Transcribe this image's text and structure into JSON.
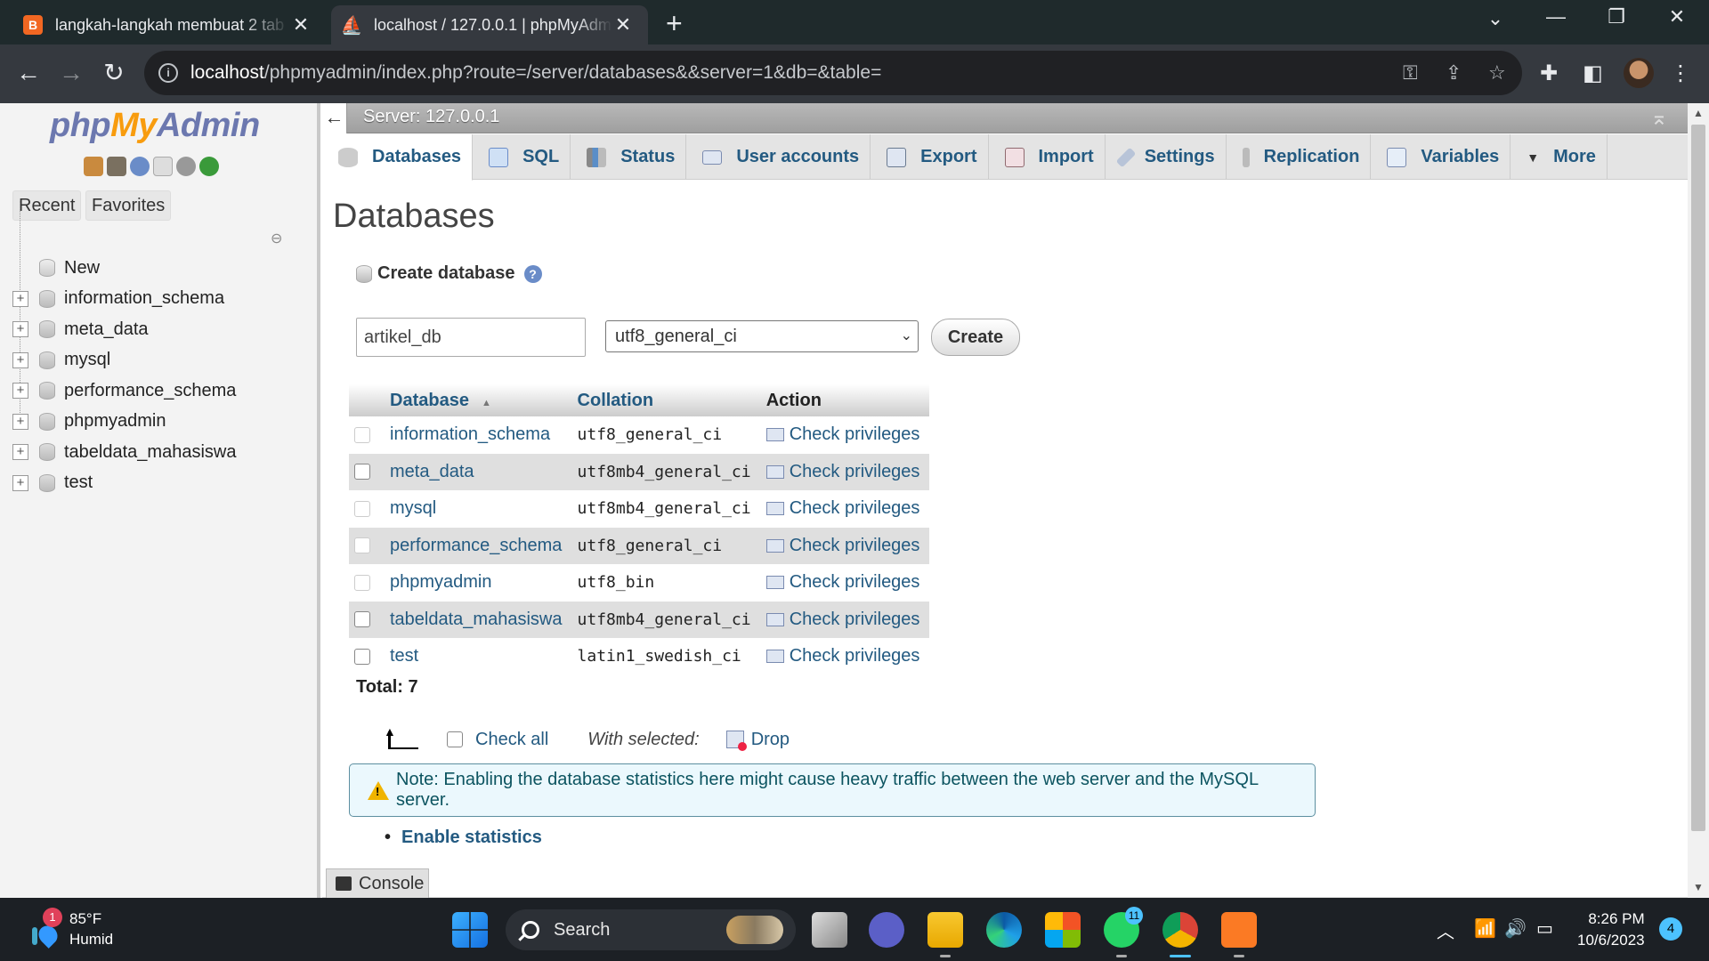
{
  "browser": {
    "tabs": [
      {
        "title": "langkah-langkah membuat 2 tab",
        "active": false,
        "favicon": "blogger-icon"
      },
      {
        "title": "localhost / 127.0.0.1 | phpMyAdmin",
        "active": true,
        "favicon": "phpmyadmin-icon"
      }
    ],
    "url_host": "localhost",
    "url_rest": "/phpmyadmin/index.php?route=/server/databases&&server=1&db=&table="
  },
  "nav": {
    "logo": {
      "php": "php",
      "my": "My",
      "admin": "Admin"
    },
    "recent_label": "Recent",
    "favorites_label": "Favorites",
    "tree": [
      {
        "label": "New",
        "new": true
      },
      {
        "label": "information_schema"
      },
      {
        "label": "meta_data"
      },
      {
        "label": "mysql"
      },
      {
        "label": "performance_schema"
      },
      {
        "label": "phpmyadmin"
      },
      {
        "label": "tabeldata_mahasiswa"
      },
      {
        "label": "test"
      }
    ]
  },
  "server_bar": {
    "label": "Server: 127.0.0.1"
  },
  "top_menu": [
    {
      "label": "Databases",
      "active": true
    },
    {
      "label": "SQL"
    },
    {
      "label": "Status"
    },
    {
      "label": "User accounts"
    },
    {
      "label": "Export"
    },
    {
      "label": "Import"
    },
    {
      "label": "Settings"
    },
    {
      "label": "Replication"
    },
    {
      "label": "Variables"
    },
    {
      "label": "More"
    }
  ],
  "page": {
    "title": "Databases",
    "create_database_label": "Create database",
    "db_name_value": "artikel_db",
    "collation_selected": "utf8_general_ci",
    "create_button": "Create",
    "table_headers": {
      "database": "Database",
      "collation": "Collation",
      "action": "Action"
    },
    "databases": [
      {
        "name": "information_schema",
        "collation": "utf8_general_ci",
        "action": "Check privileges"
      },
      {
        "name": "meta_data",
        "collation": "utf8mb4_general_ci",
        "action": "Check privileges"
      },
      {
        "name": "mysql",
        "collation": "utf8mb4_general_ci",
        "action": "Check privileges"
      },
      {
        "name": "performance_schema",
        "collation": "utf8_general_ci",
        "action": "Check privileges"
      },
      {
        "name": "phpmyadmin",
        "collation": "utf8_bin",
        "action": "Check privileges"
      },
      {
        "name": "tabeldata_mahasiswa",
        "collation": "utf8mb4_general_ci",
        "action": "Check privileges"
      },
      {
        "name": "test",
        "collation": "latin1_swedish_ci",
        "action": "Check privileges"
      }
    ],
    "total": "Total: 7",
    "check_all": "Check all",
    "with_selected": "With selected:",
    "drop": "Drop",
    "note": "Note: Enabling the database statistics here might cause heavy traffic between the web server and the MySQL server.",
    "enable_statistics": "Enable statistics",
    "console": "Console"
  },
  "taskbar": {
    "weather_temp": "85°F",
    "weather_desc": "Humid",
    "weather_badge": "1",
    "search_label": "Search",
    "whatsapp_badge": "11",
    "time": "8:26 PM",
    "date": "10/6/2023",
    "notifications": "4"
  }
}
